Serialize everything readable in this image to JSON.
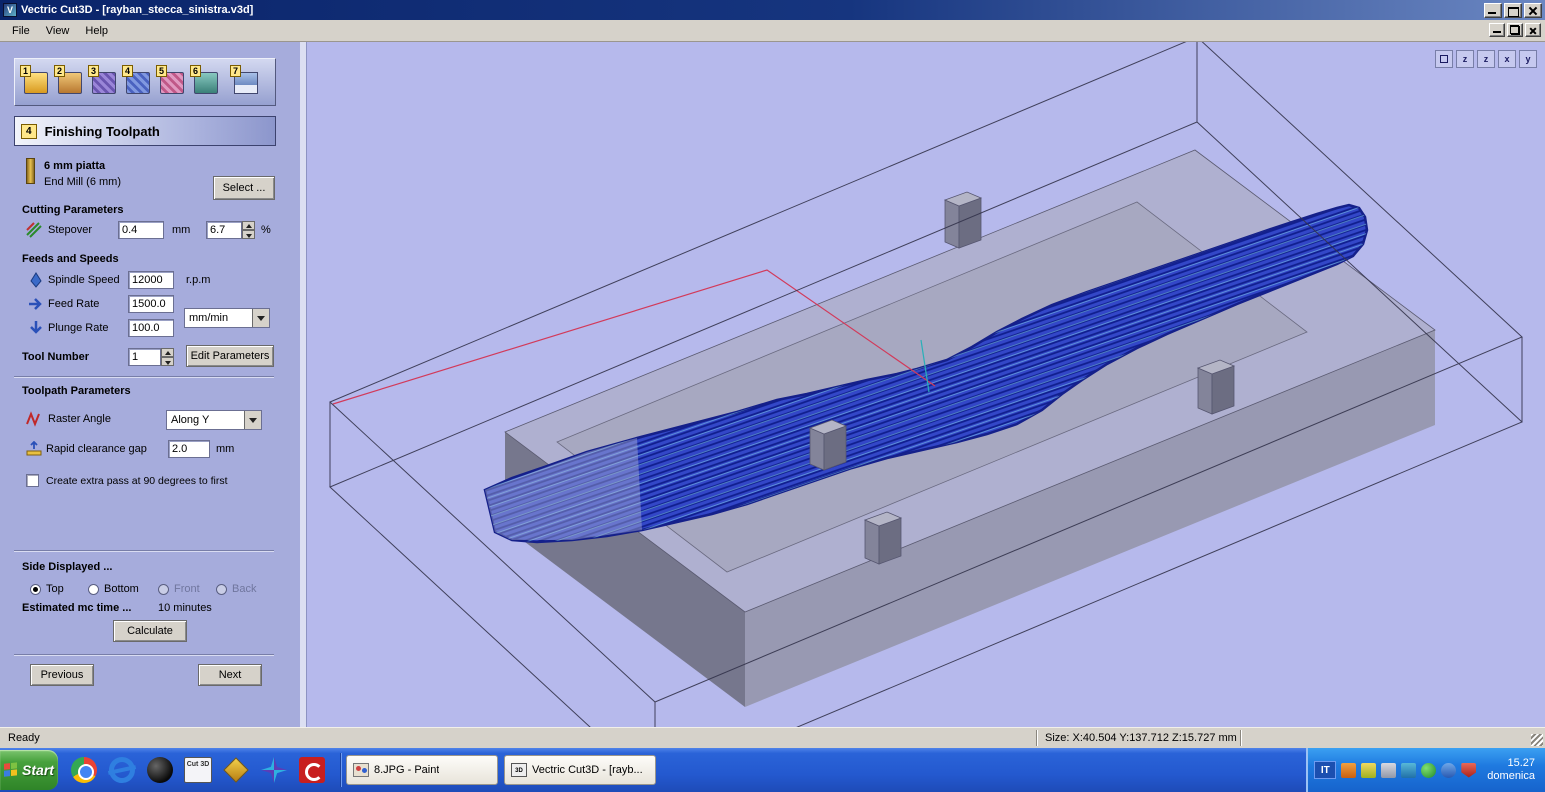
{
  "titlebar": {
    "title": "Vectric Cut3D - [rayban_stecca_sinistra.v3d]"
  },
  "menubar": {
    "items": [
      {
        "label": "File"
      },
      {
        "label": "View"
      },
      {
        "label": "Help"
      }
    ]
  },
  "steps": {
    "numbers": [
      "1",
      "2",
      "3",
      "4",
      "5",
      "6",
      "7"
    ]
  },
  "panel": {
    "header": {
      "step": "4",
      "title": "Finishing Toolpath"
    },
    "tool": {
      "name": "6 mm piatta",
      "desc": "End Mill (6 mm)",
      "select": "Select ..."
    },
    "cutting": {
      "title": "Cutting Parameters",
      "stepover": {
        "label": "Stepover",
        "value": "0.4",
        "unit": "mm",
        "percent": "6.7",
        "percent_unit": "%"
      }
    },
    "feeds": {
      "title": "Feeds and Speeds",
      "spindle": {
        "label": "Spindle Speed",
        "value": "12000",
        "unit": "r.p.m"
      },
      "feed": {
        "label": "Feed Rate",
        "value": "1500.0"
      },
      "plunge": {
        "label": "Plunge Rate",
        "value": "100.0"
      },
      "units": {
        "value": "mm/min"
      },
      "tool_number": {
        "label": "Tool Number",
        "value": "1"
      },
      "edit": "Edit Parameters"
    },
    "toolpath": {
      "title": "Toolpath Parameters",
      "raster": {
        "label": "Raster Angle",
        "value": "Along Y"
      },
      "clearance": {
        "label": "Rapid clearance gap",
        "value": "2.0",
        "unit": "mm"
      },
      "extra_pass": "Create extra pass at 90 degrees to first"
    },
    "side": {
      "title": "Side Displayed ...",
      "options": [
        {
          "label": "Top",
          "selected": true
        },
        {
          "label": "Bottom",
          "selected": false
        },
        {
          "label": "Front",
          "selected": false,
          "disabled": true
        },
        {
          "label": "Back",
          "selected": false,
          "disabled": true
        }
      ],
      "estimated_label": "Estimated mc time ...",
      "estimated_value": "10 minutes",
      "calculate": "Calculate"
    },
    "nav": {
      "previous": "Previous",
      "next": "Next"
    }
  },
  "viewport": {
    "view_icons": [
      {
        "label": ""
      },
      {
        "label": "z"
      },
      {
        "label": "z"
      },
      {
        "label": "x"
      },
      {
        "label": "y"
      }
    ]
  },
  "statusbar": {
    "ready": "Ready",
    "size": "Size: X:40.504 Y:137.712 Z:15.727 mm"
  },
  "taskbar": {
    "start": "Start",
    "quicklaunch": {
      "cut3d_label": "Cut 3D"
    },
    "tasks": [
      {
        "label": "8.JPG - Paint"
      },
      {
        "label": "Vectric Cut3D - [rayb..."
      }
    ],
    "lang": "IT",
    "time": "15.27",
    "day": "domenica"
  }
}
